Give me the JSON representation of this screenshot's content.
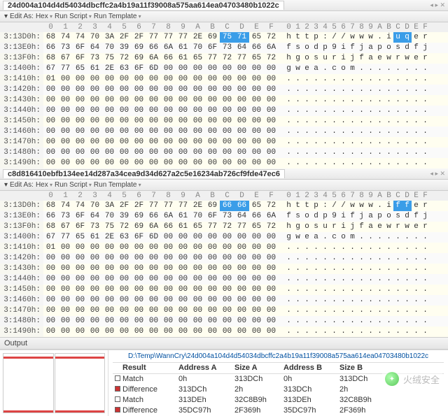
{
  "tabs": {
    "top": "24d004a104d4d54034dbcffc2a4b19a11f39008a575aa614ea04703480b1022c",
    "mid": "c8d816410ebfb134ee14d287a34cea9d34d627a2c5e16234ab726cf9fde47ec6"
  },
  "toolbar": {
    "edit_as": "Edit As:",
    "hex": "Hex",
    "run_script": "Run Script",
    "run_template": "Run Template"
  },
  "hex_header_cols": [
    "0",
    "1",
    "2",
    "3",
    "4",
    "5",
    "6",
    "7",
    "8",
    "9",
    "A",
    "B",
    "C",
    "D",
    "E",
    "F"
  ],
  "ascii_header_cols": [
    "0",
    "1",
    "2",
    "3",
    "4",
    "5",
    "6",
    "7",
    "8",
    "9",
    "A",
    "B",
    "C",
    "D",
    "E",
    "F"
  ],
  "panes": [
    {
      "highlight_hex_start": 12,
      "highlight_hex_end": 13,
      "highlight_ascii_start": 12,
      "highlight_ascii_end": 13,
      "rows": [
        {
          "off": "3:13D0h:",
          "hex": [
            "68",
            "74",
            "74",
            "70",
            "3A",
            "2F",
            "2F",
            "77",
            "77",
            "77",
            "2E",
            "69",
            "75",
            "71",
            "65",
            "72"
          ],
          "asc": [
            "h",
            "t",
            "t",
            "p",
            ":",
            "/",
            "/",
            "w",
            "w",
            "w",
            ".",
            "i",
            "u",
            "q",
            "e",
            "r"
          ]
        },
        {
          "off": "3:13E0h:",
          "hex": [
            "66",
            "73",
            "6F",
            "64",
            "70",
            "39",
            "69",
            "66",
            "6A",
            "61",
            "70",
            "6F",
            "73",
            "64",
            "66",
            "6A"
          ],
          "asc": [
            "f",
            "s",
            "o",
            "d",
            "p",
            "9",
            "i",
            "f",
            "j",
            "a",
            "p",
            "o",
            "s",
            "d",
            "f",
            "j"
          ]
        },
        {
          "off": "3:13F0h:",
          "hex": [
            "68",
            "67",
            "6F",
            "73",
            "75",
            "72",
            "69",
            "6A",
            "66",
            "61",
            "65",
            "77",
            "72",
            "77",
            "65",
            "72"
          ],
          "asc": [
            "h",
            "g",
            "o",
            "s",
            "u",
            "r",
            "i",
            "j",
            "f",
            "a",
            "e",
            "w",
            "r",
            "w",
            "e",
            "r"
          ]
        },
        {
          "off": "3:1400h:",
          "hex": [
            "67",
            "77",
            "65",
            "61",
            "2E",
            "63",
            "6F",
            "6D",
            "00",
            "00",
            "00",
            "00",
            "00",
            "00",
            "00",
            "00"
          ],
          "asc": [
            "g",
            "w",
            "e",
            "a",
            ".",
            "c",
            "o",
            "m",
            ".",
            ".",
            ".",
            ".",
            ".",
            ".",
            ".",
            "."
          ]
        },
        {
          "off": "3:1410h:",
          "hex": [
            "01",
            "00",
            "00",
            "00",
            "00",
            "00",
            "00",
            "00",
            "00",
            "00",
            "00",
            "00",
            "00",
            "00",
            "00",
            "00"
          ],
          "asc": [
            ".",
            ".",
            ".",
            ".",
            ".",
            ".",
            ".",
            ".",
            ".",
            ".",
            ".",
            ".",
            ".",
            ".",
            ".",
            "."
          ]
        },
        {
          "off": "3:1420h:",
          "hex": [
            "00",
            "00",
            "00",
            "00",
            "00",
            "00",
            "00",
            "00",
            "00",
            "00",
            "00",
            "00",
            "00",
            "00",
            "00",
            "00"
          ],
          "asc": [
            ".",
            ".",
            ".",
            ".",
            ".",
            ".",
            ".",
            ".",
            ".",
            ".",
            ".",
            ".",
            ".",
            ".",
            ".",
            "."
          ]
        },
        {
          "off": "3:1430h:",
          "hex": [
            "00",
            "00",
            "00",
            "00",
            "00",
            "00",
            "00",
            "00",
            "00",
            "00",
            "00",
            "00",
            "00",
            "00",
            "00",
            "00"
          ],
          "asc": [
            ".",
            ".",
            ".",
            ".",
            ".",
            ".",
            ".",
            ".",
            ".",
            ".",
            ".",
            ".",
            ".",
            ".",
            ".",
            "."
          ]
        },
        {
          "off": "3:1440h:",
          "hex": [
            "00",
            "00",
            "00",
            "00",
            "00",
            "00",
            "00",
            "00",
            "00",
            "00",
            "00",
            "00",
            "00",
            "00",
            "00",
            "00"
          ],
          "asc": [
            ".",
            ".",
            ".",
            ".",
            ".",
            ".",
            ".",
            ".",
            ".",
            ".",
            ".",
            ".",
            ".",
            ".",
            ".",
            "."
          ]
        },
        {
          "off": "3:1450h:",
          "hex": [
            "00",
            "00",
            "00",
            "00",
            "00",
            "00",
            "00",
            "00",
            "00",
            "00",
            "00",
            "00",
            "00",
            "00",
            "00",
            "00"
          ],
          "asc": [
            ".",
            ".",
            ".",
            ".",
            ".",
            ".",
            ".",
            ".",
            ".",
            ".",
            ".",
            ".",
            ".",
            ".",
            ".",
            "."
          ]
        },
        {
          "off": "3:1460h:",
          "hex": [
            "00",
            "00",
            "00",
            "00",
            "00",
            "00",
            "00",
            "00",
            "00",
            "00",
            "00",
            "00",
            "00",
            "00",
            "00",
            "00"
          ],
          "asc": [
            ".",
            ".",
            ".",
            ".",
            ".",
            ".",
            ".",
            ".",
            ".",
            ".",
            ".",
            ".",
            ".",
            ".",
            ".",
            "."
          ]
        },
        {
          "off": "3:1470h:",
          "hex": [
            "00",
            "00",
            "00",
            "00",
            "00",
            "00",
            "00",
            "00",
            "00",
            "00",
            "00",
            "00",
            "00",
            "00",
            "00",
            "00"
          ],
          "asc": [
            ".",
            ".",
            ".",
            ".",
            ".",
            ".",
            ".",
            ".",
            ".",
            ".",
            ".",
            ".",
            ".",
            ".",
            ".",
            "."
          ]
        },
        {
          "off": "3:1480h:",
          "hex": [
            "00",
            "00",
            "00",
            "00",
            "00",
            "00",
            "00",
            "00",
            "00",
            "00",
            "00",
            "00",
            "00",
            "00",
            "00",
            "00"
          ],
          "asc": [
            ".",
            ".",
            ".",
            ".",
            ".",
            ".",
            ".",
            ".",
            ".",
            ".",
            ".",
            ".",
            ".",
            ".",
            ".",
            "."
          ]
        },
        {
          "off": "3:1490h:",
          "hex": [
            "00",
            "00",
            "00",
            "00",
            "00",
            "00",
            "00",
            "00",
            "00",
            "00",
            "00",
            "00",
            "00",
            "00",
            "00",
            "00"
          ],
          "asc": [
            ".",
            ".",
            ".",
            ".",
            ".",
            ".",
            ".",
            ".",
            ".",
            ".",
            ".",
            ".",
            ".",
            ".",
            ".",
            "."
          ]
        }
      ]
    },
    {
      "highlight_hex_start": 12,
      "highlight_hex_end": 13,
      "highlight_ascii_start": 12,
      "highlight_ascii_end": 13,
      "rows": [
        {
          "off": "3:13D0h:",
          "hex": [
            "68",
            "74",
            "74",
            "70",
            "3A",
            "2F",
            "2F",
            "77",
            "77",
            "77",
            "2E",
            "69",
            "66",
            "66",
            "65",
            "72"
          ],
          "asc": [
            "h",
            "t",
            "t",
            "p",
            ":",
            "/",
            "/",
            "w",
            "w",
            "w",
            ".",
            "i",
            "f",
            "f",
            "e",
            "r"
          ]
        },
        {
          "off": "3:13E0h:",
          "hex": [
            "66",
            "73",
            "6F",
            "64",
            "70",
            "39",
            "69",
            "66",
            "6A",
            "61",
            "70",
            "6F",
            "73",
            "64",
            "66",
            "6A"
          ],
          "asc": [
            "f",
            "s",
            "o",
            "d",
            "p",
            "9",
            "i",
            "f",
            "j",
            "a",
            "p",
            "o",
            "s",
            "d",
            "f",
            "j"
          ]
        },
        {
          "off": "3:13F0h:",
          "hex": [
            "68",
            "67",
            "6F",
            "73",
            "75",
            "72",
            "69",
            "6A",
            "66",
            "61",
            "65",
            "77",
            "72",
            "77",
            "65",
            "72"
          ],
          "asc": [
            "h",
            "g",
            "o",
            "s",
            "u",
            "r",
            "i",
            "j",
            "f",
            "a",
            "e",
            "w",
            "r",
            "w",
            "e",
            "r"
          ]
        },
        {
          "off": "3:1400h:",
          "hex": [
            "67",
            "77",
            "65",
            "61",
            "2E",
            "63",
            "6F",
            "6D",
            "00",
            "00",
            "00",
            "00",
            "00",
            "00",
            "00",
            "00"
          ],
          "asc": [
            "g",
            "w",
            "e",
            "a",
            ".",
            "c",
            "o",
            "m",
            ".",
            ".",
            ".",
            ".",
            ".",
            ".",
            ".",
            "."
          ]
        },
        {
          "off": "3:1410h:",
          "hex": [
            "01",
            "00",
            "00",
            "00",
            "00",
            "00",
            "00",
            "00",
            "00",
            "00",
            "00",
            "00",
            "00",
            "00",
            "00",
            "00"
          ],
          "asc": [
            ".",
            ".",
            ".",
            ".",
            ".",
            ".",
            ".",
            ".",
            ".",
            ".",
            ".",
            ".",
            ".",
            ".",
            ".",
            "."
          ]
        },
        {
          "off": "3:1420h:",
          "hex": [
            "00",
            "00",
            "00",
            "00",
            "00",
            "00",
            "00",
            "00",
            "00",
            "00",
            "00",
            "00",
            "00",
            "00",
            "00",
            "00"
          ],
          "asc": [
            ".",
            ".",
            ".",
            ".",
            ".",
            ".",
            ".",
            ".",
            ".",
            ".",
            ".",
            ".",
            ".",
            ".",
            ".",
            "."
          ]
        },
        {
          "off": "3:1430h:",
          "hex": [
            "00",
            "00",
            "00",
            "00",
            "00",
            "00",
            "00",
            "00",
            "00",
            "00",
            "00",
            "00",
            "00",
            "00",
            "00",
            "00"
          ],
          "asc": [
            ".",
            ".",
            ".",
            ".",
            ".",
            ".",
            ".",
            ".",
            ".",
            ".",
            ".",
            ".",
            ".",
            ".",
            ".",
            "."
          ]
        },
        {
          "off": "3:1440h:",
          "hex": [
            "00",
            "00",
            "00",
            "00",
            "00",
            "00",
            "00",
            "00",
            "00",
            "00",
            "00",
            "00",
            "00",
            "00",
            "00",
            "00"
          ],
          "asc": [
            ".",
            ".",
            ".",
            ".",
            ".",
            ".",
            ".",
            ".",
            ".",
            ".",
            ".",
            ".",
            ".",
            ".",
            ".",
            "."
          ]
        },
        {
          "off": "3:1450h:",
          "hex": [
            "00",
            "00",
            "00",
            "00",
            "00",
            "00",
            "00",
            "00",
            "00",
            "00",
            "00",
            "00",
            "00",
            "00",
            "00",
            "00"
          ],
          "asc": [
            ".",
            ".",
            ".",
            ".",
            ".",
            ".",
            ".",
            ".",
            ".",
            ".",
            ".",
            ".",
            ".",
            ".",
            ".",
            "."
          ]
        },
        {
          "off": "3:1460h:",
          "hex": [
            "00",
            "00",
            "00",
            "00",
            "00",
            "00",
            "00",
            "00",
            "00",
            "00",
            "00",
            "00",
            "00",
            "00",
            "00",
            "00"
          ],
          "asc": [
            ".",
            ".",
            ".",
            ".",
            ".",
            ".",
            ".",
            ".",
            ".",
            ".",
            ".",
            ".",
            ".",
            ".",
            ".",
            "."
          ]
        },
        {
          "off": "3:1470h:",
          "hex": [
            "00",
            "00",
            "00",
            "00",
            "00",
            "00",
            "00",
            "00",
            "00",
            "00",
            "00",
            "00",
            "00",
            "00",
            "00",
            "00"
          ],
          "asc": [
            ".",
            ".",
            ".",
            ".",
            ".",
            ".",
            ".",
            ".",
            ".",
            ".",
            ".",
            ".",
            ".",
            ".",
            ".",
            "."
          ]
        },
        {
          "off": "3:1480h:",
          "hex": [
            "00",
            "00",
            "00",
            "00",
            "00",
            "00",
            "00",
            "00",
            "00",
            "00",
            "00",
            "00",
            "00",
            "00",
            "00",
            "00"
          ],
          "asc": [
            ".",
            ".",
            ".",
            ".",
            ".",
            ".",
            ".",
            ".",
            ".",
            ".",
            ".",
            ".",
            ".",
            ".",
            ".",
            "."
          ]
        },
        {
          "off": "3:1490h:",
          "hex": [
            "00",
            "00",
            "00",
            "00",
            "00",
            "00",
            "00",
            "00",
            "00",
            "00",
            "00",
            "00",
            "00",
            "00",
            "00",
            "00"
          ],
          "asc": [
            ".",
            ".",
            ".",
            ".",
            ".",
            ".",
            ".",
            ".",
            ".",
            ".",
            ".",
            ".",
            ".",
            ".",
            ".",
            "."
          ]
        }
      ]
    }
  ],
  "output": {
    "label": "Output",
    "path": "D:\\Temp\\WannCry\\24d004a104d4d54034dbcffc2a4b19a11f39008a575aa614ea04703480b1022c",
    "headers": {
      "result": "Result",
      "addrA": "Address A",
      "sizeA": "Size A",
      "addrB": "Address B",
      "sizeB": "Size B"
    },
    "rows": [
      {
        "type": "match",
        "result": "Match",
        "addrA": "0h",
        "sizeA": "313DCh",
        "addrB": "0h",
        "sizeB": "313DCh"
      },
      {
        "type": "diff",
        "result": "Difference",
        "addrA": "313DCh",
        "sizeA": "2h",
        "addrB": "313DCh",
        "sizeB": "2h"
      },
      {
        "type": "match",
        "result": "Match",
        "addrA": "313DEh",
        "sizeA": "32C8B9h",
        "addrB": "313DEh",
        "sizeB": "32C8B9h"
      },
      {
        "type": "diff",
        "result": "Difference",
        "addrA": "35DC97h",
        "sizeA": "2F369h",
        "addrB": "35DC97h",
        "sizeB": "2F369h"
      }
    ]
  },
  "watermark": {
    "text": "火绒安全"
  }
}
